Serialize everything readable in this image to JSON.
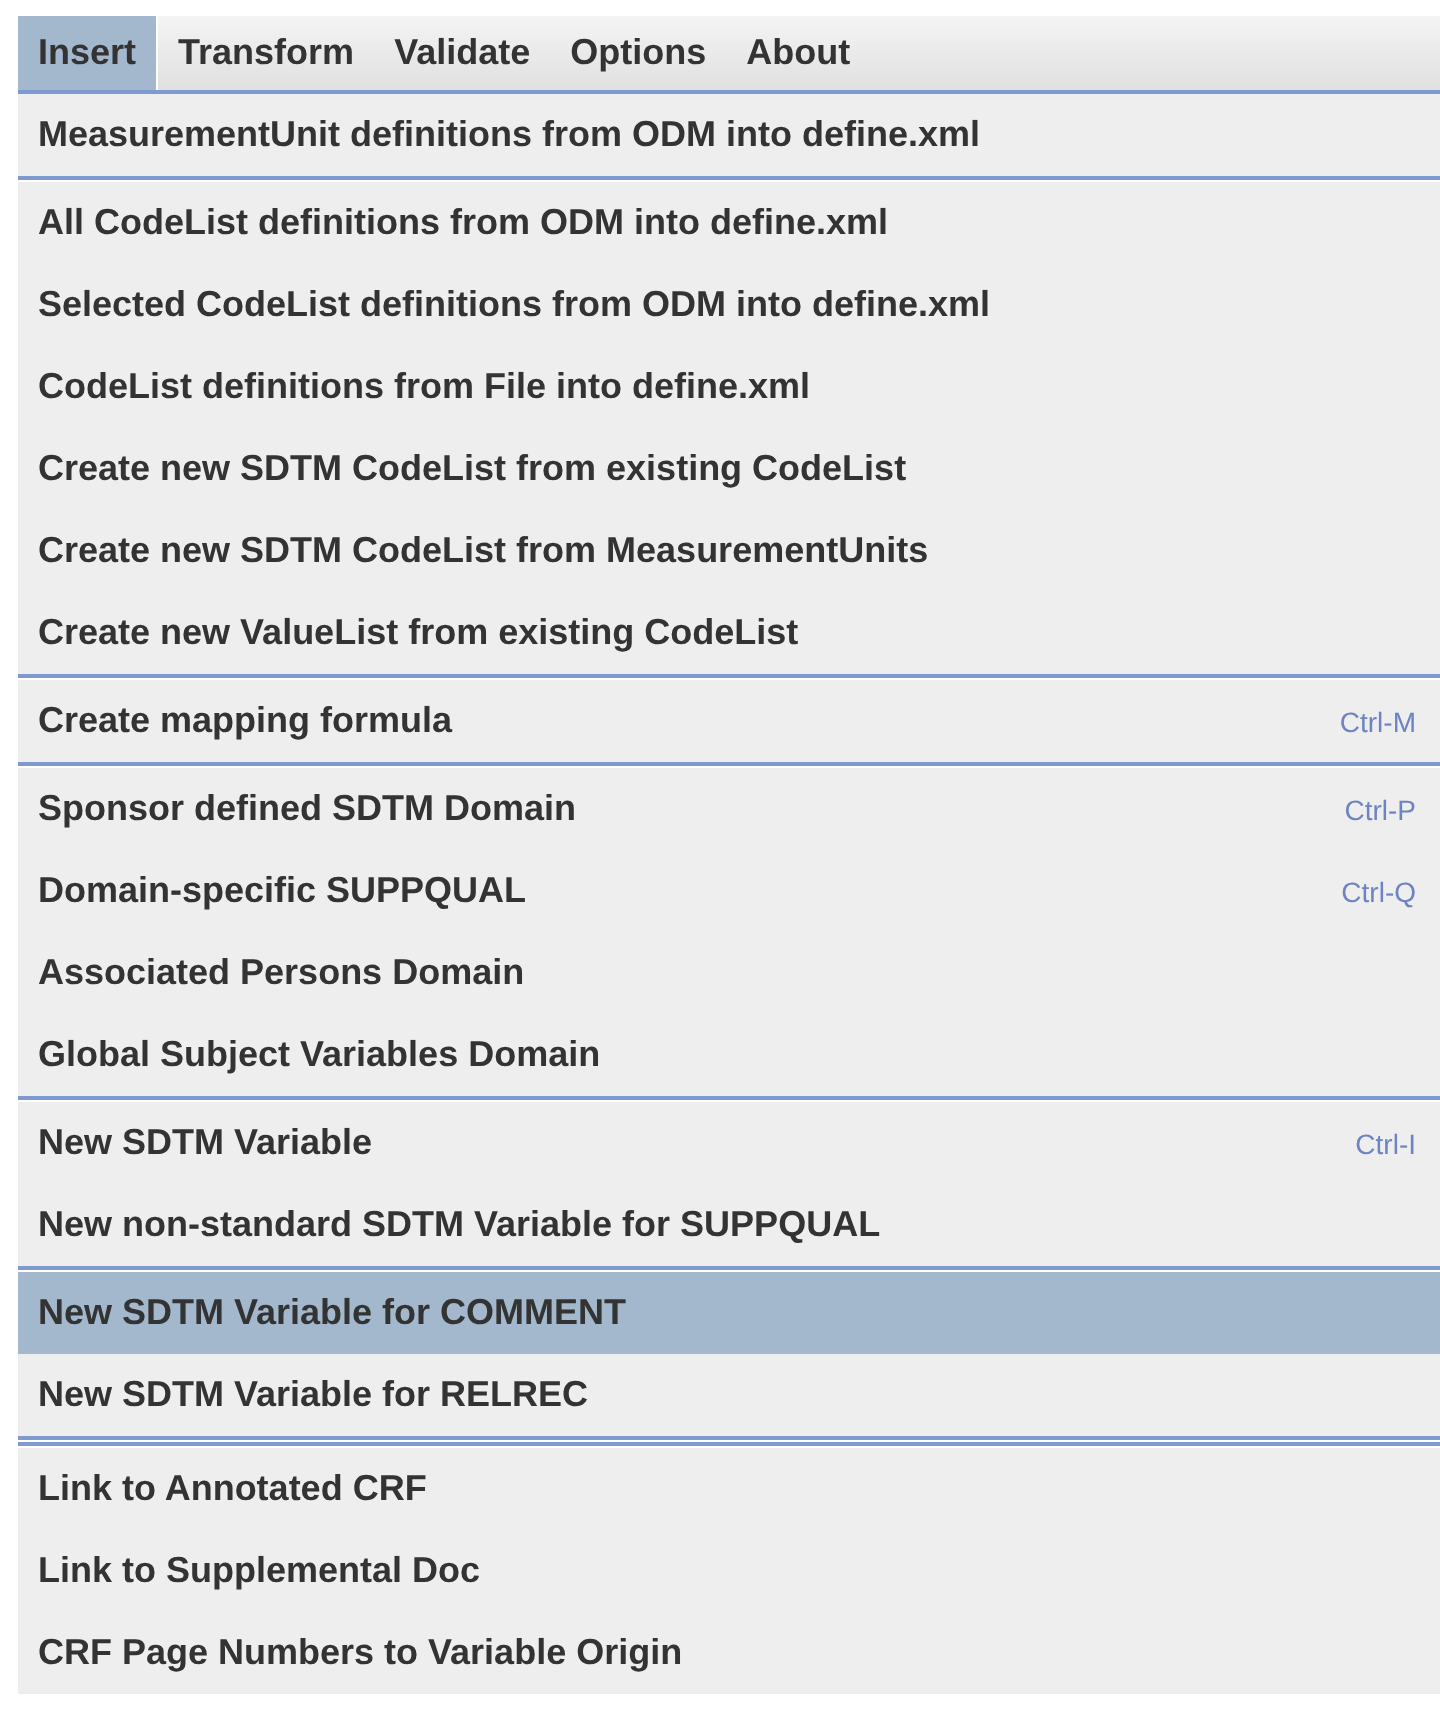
{
  "menubar": [
    {
      "label": "Insert",
      "selected": true
    },
    {
      "label": "Transform",
      "selected": false
    },
    {
      "label": "Validate",
      "selected": false
    },
    {
      "label": "Options",
      "selected": false
    },
    {
      "label": "About",
      "selected": false
    }
  ],
  "menu": [
    {
      "kind": "item",
      "label": "MeasurementUnit definitions from ODM into define.xml",
      "selected": false
    },
    {
      "kind": "separator"
    },
    {
      "kind": "item",
      "label": "All CodeList definitions from ODM into define.xml",
      "selected": false
    },
    {
      "kind": "item",
      "label": "Selected CodeList definitions from ODM into define.xml",
      "selected": false
    },
    {
      "kind": "item",
      "label": "CodeList definitions from File into define.xml",
      "selected": false
    },
    {
      "kind": "item",
      "label": "Create new SDTM CodeList from existing CodeList",
      "selected": false
    },
    {
      "kind": "item",
      "label": "Create new SDTM CodeList from MeasurementUnits",
      "selected": false
    },
    {
      "kind": "item",
      "label": "Create new ValueList from existing CodeList",
      "selected": false
    },
    {
      "kind": "separator"
    },
    {
      "kind": "item",
      "label": "Create mapping formula",
      "shortcut": "Ctrl-M",
      "selected": false
    },
    {
      "kind": "separator"
    },
    {
      "kind": "item",
      "label": "Sponsor defined SDTM Domain",
      "shortcut": "Ctrl-P",
      "selected": false
    },
    {
      "kind": "item",
      "label": "Domain-specific SUPPQUAL",
      "shortcut": "Ctrl-Q",
      "selected": false
    },
    {
      "kind": "item",
      "label": "Associated Persons Domain",
      "selected": false
    },
    {
      "kind": "item",
      "label": "Global Subject Variables Domain",
      "selected": false
    },
    {
      "kind": "separator"
    },
    {
      "kind": "item",
      "label": "New SDTM Variable",
      "shortcut": "Ctrl-I",
      "selected": false
    },
    {
      "kind": "item",
      "label": "New non-standard SDTM Variable for SUPPQUAL",
      "selected": false
    },
    {
      "kind": "separator"
    },
    {
      "kind": "item",
      "label": "New SDTM Variable for COMMENT",
      "selected": true
    },
    {
      "kind": "item",
      "label": "New SDTM Variable for RELREC",
      "selected": false
    },
    {
      "kind": "separator"
    },
    {
      "kind": "separator"
    },
    {
      "kind": "item",
      "label": "Link to Annotated CRF",
      "selected": false
    },
    {
      "kind": "item",
      "label": "Link to Supplemental Doc",
      "selected": false
    },
    {
      "kind": "item",
      "label": "CRF Page Numbers to Variable Origin",
      "selected": false
    }
  ]
}
